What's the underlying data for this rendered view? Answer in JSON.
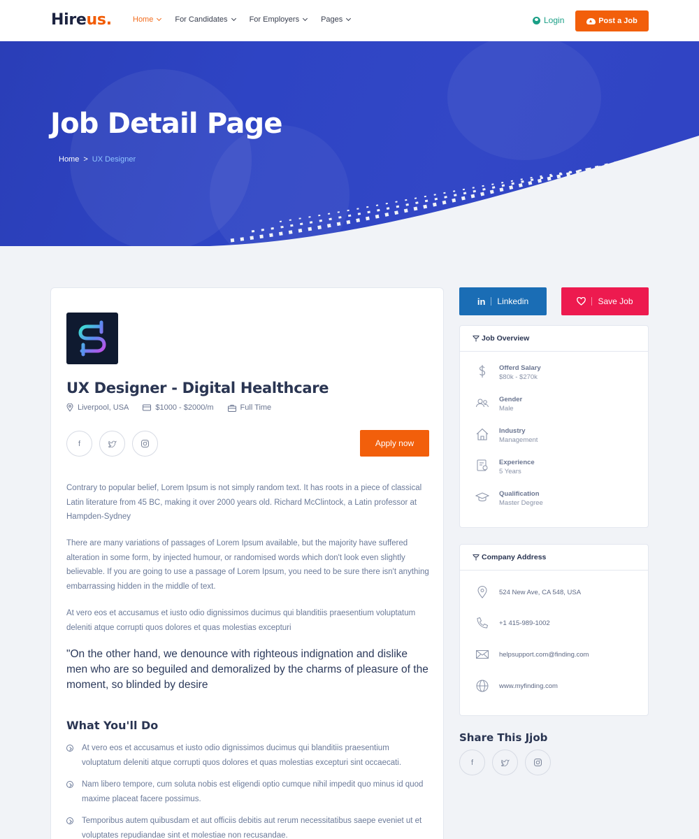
{
  "header": {
    "logo_part1": "Hire",
    "logo_part2": "us.",
    "nav": [
      {
        "label": "Home"
      },
      {
        "label": "For Candidates"
      },
      {
        "label": "For Employers"
      },
      {
        "label": "Pages"
      }
    ],
    "login_label": "Login",
    "post_job_label": "Post a Job"
  },
  "hero": {
    "title": "Job Detail Page",
    "breadcrumb": {
      "home": "Home",
      "separator": ">",
      "current": "UX Designer"
    }
  },
  "job": {
    "title": "UX Designer - Digital Healthcare",
    "location": "Liverpool, USA",
    "salary": "$1000 - $2000/m",
    "type": "Full Time",
    "apply_label": "Apply now",
    "social_icons": [
      "facebook-icon",
      "twitter-icon",
      "instagram-icon"
    ],
    "paragraphs": [
      "Contrary to popular belief, Lorem Ipsum is not simply random text. It has roots in a piece of classical Latin literature from 45 BC, making it over 2000 years old. Richard McClintock, a Latin professor at Hampden-Sydney",
      "There are many variations of passages of Lorem Ipsum available, but the majority have suffered alteration in some form, by injected humour, or randomised words which don't look even slightly believable. If you are going to use a passage of Lorem Ipsum, you need to be sure there isn't anything embarrassing hidden in the middle of text.",
      "At vero eos et accusamus et iusto odio dignissimos ducimus qui blanditiis praesentium voluptatum deleniti atque corrupti quos dolores et quas molestias excepturi"
    ],
    "quote": "\"On the other hand, we denounce with righteous indignation and dislike men who are so beguiled and demoralized by the charms of pleasure of the moment, so blinded by desire",
    "section_title": "What You'll Do",
    "todo": [
      "At vero eos et accusamus et iusto odio dignissimos ducimus qui blanditiis praesentium voluptatum deleniti atque corrupti quos dolores et quas molestias excepturi sint occaecati.",
      "Nam libero tempore, cum soluta nobis est eligendi optio cumque nihil impedit quo minus id quod maxime placeat facere possimus.",
      "Temporibus autem quibusdam et aut officiis debitis aut rerum necessitatibus saepe eveniet ut et voluptates repudiandae sint et molestiae non recusandae."
    ]
  },
  "sidebar": {
    "linkedin_label": "Linkedin",
    "save_label": "Save Job",
    "overview": {
      "title": "Job Overview",
      "items": [
        {
          "label": "Offerd Salary",
          "value": "$80k - $270k",
          "icon": "dollar-icon"
        },
        {
          "label": "Gender",
          "value": "Male",
          "icon": "users-icon"
        },
        {
          "label": "Industry",
          "value": "Management",
          "icon": "home-icon"
        },
        {
          "label": "Experience",
          "value": "5 Years",
          "icon": "certificate-icon"
        },
        {
          "label": "Qualification",
          "value": "Master Degree",
          "icon": "graduation-cap-icon"
        }
      ]
    },
    "address": {
      "title": "Company Address",
      "items": [
        {
          "value": "524 New Ave, CA 548, USA",
          "icon": "map-pin-icon"
        },
        {
          "value": "+1 415-989-1002",
          "icon": "phone-icon"
        },
        {
          "value": "helpsupport.com@finding.com",
          "icon": "mail-icon"
        },
        {
          "value": "www.myfinding.com",
          "icon": "globe-icon"
        }
      ]
    },
    "share_title": "Share This Jjob"
  },
  "colors": {
    "accent": "#f25f0b",
    "hero_blue": "#2e44c4",
    "linkedin": "#1a6db5",
    "save": "#ed1a4f",
    "login": "#1a9f86"
  }
}
